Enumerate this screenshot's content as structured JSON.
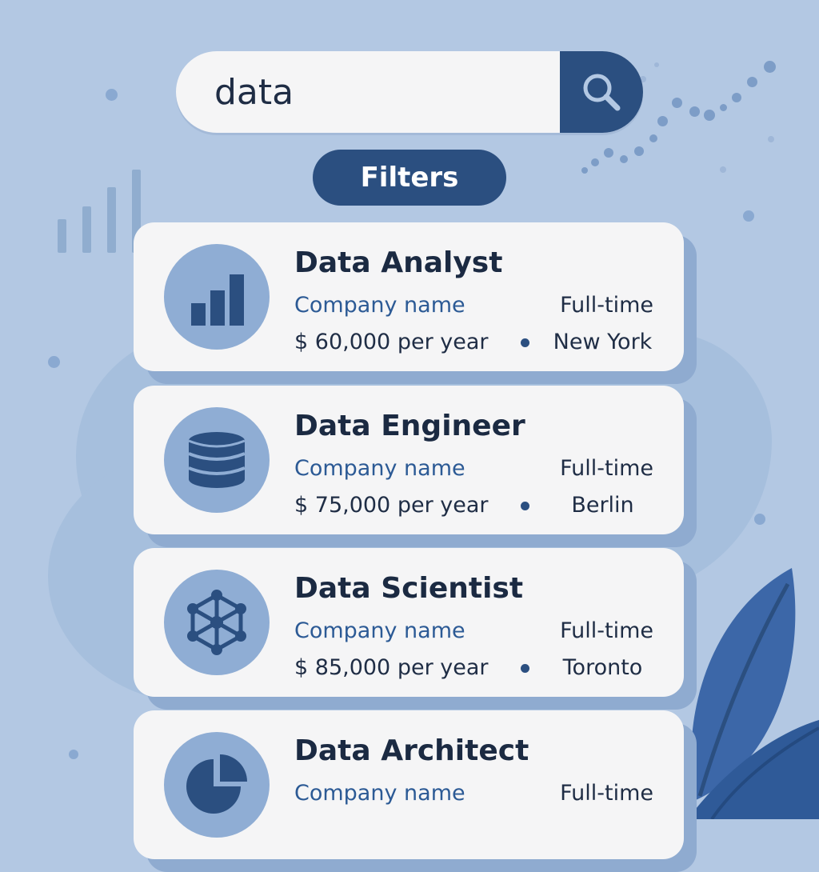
{
  "search": {
    "value": "data",
    "icon": "search-icon"
  },
  "filters": {
    "label": "Filters"
  },
  "colors": {
    "background": "#b3c8e3",
    "accent": "#2b4f80",
    "card": "#f5f5f6",
    "icon_circle": "#8fadd4",
    "company_link": "#2c5a95"
  },
  "jobs": [
    {
      "title": "Data Analyst",
      "company": "Company name",
      "type": "Full-time",
      "salary": "$ 60,000 per year",
      "location": "New York",
      "icon": "bar-chart-icon"
    },
    {
      "title": "Data Engineer",
      "company": "Company name",
      "type": "Full-time",
      "salary": "$ 75,000 per year",
      "location": "Berlin",
      "icon": "database-icon"
    },
    {
      "title": "Data Scientist",
      "company": "Company name",
      "type": "Full-time",
      "salary": "$ 85,000 per year",
      "location": "Toronto",
      "icon": "network-icon"
    },
    {
      "title": "Data Architect",
      "company": "Company name",
      "type": "Full-time",
      "icon": "pie-chart-icon"
    }
  ]
}
